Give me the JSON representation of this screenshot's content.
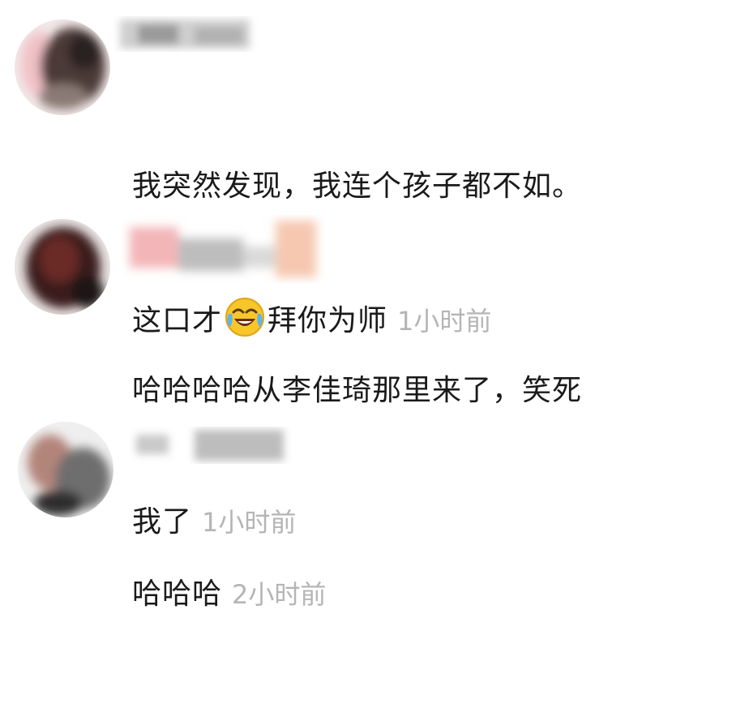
{
  "comments": [
    {
      "line1": "我突然发现，我连个孩子都不如。",
      "line2_before_emoji": "这口才",
      "emoji": "laughing-crying-emoji",
      "line2_after_emoji": "拜你为师",
      "time": "1小时前"
    },
    {
      "line1": "哈哈哈哈从李佳琦那里来了，笑死",
      "line2": "我了",
      "time": "1小时前"
    },
    {
      "line1": "哈哈哈",
      "time": "2小时前"
    }
  ],
  "colors": {
    "text": "#1a1a1a",
    "time": "#b5b5b5",
    "background": "#ffffff"
  }
}
